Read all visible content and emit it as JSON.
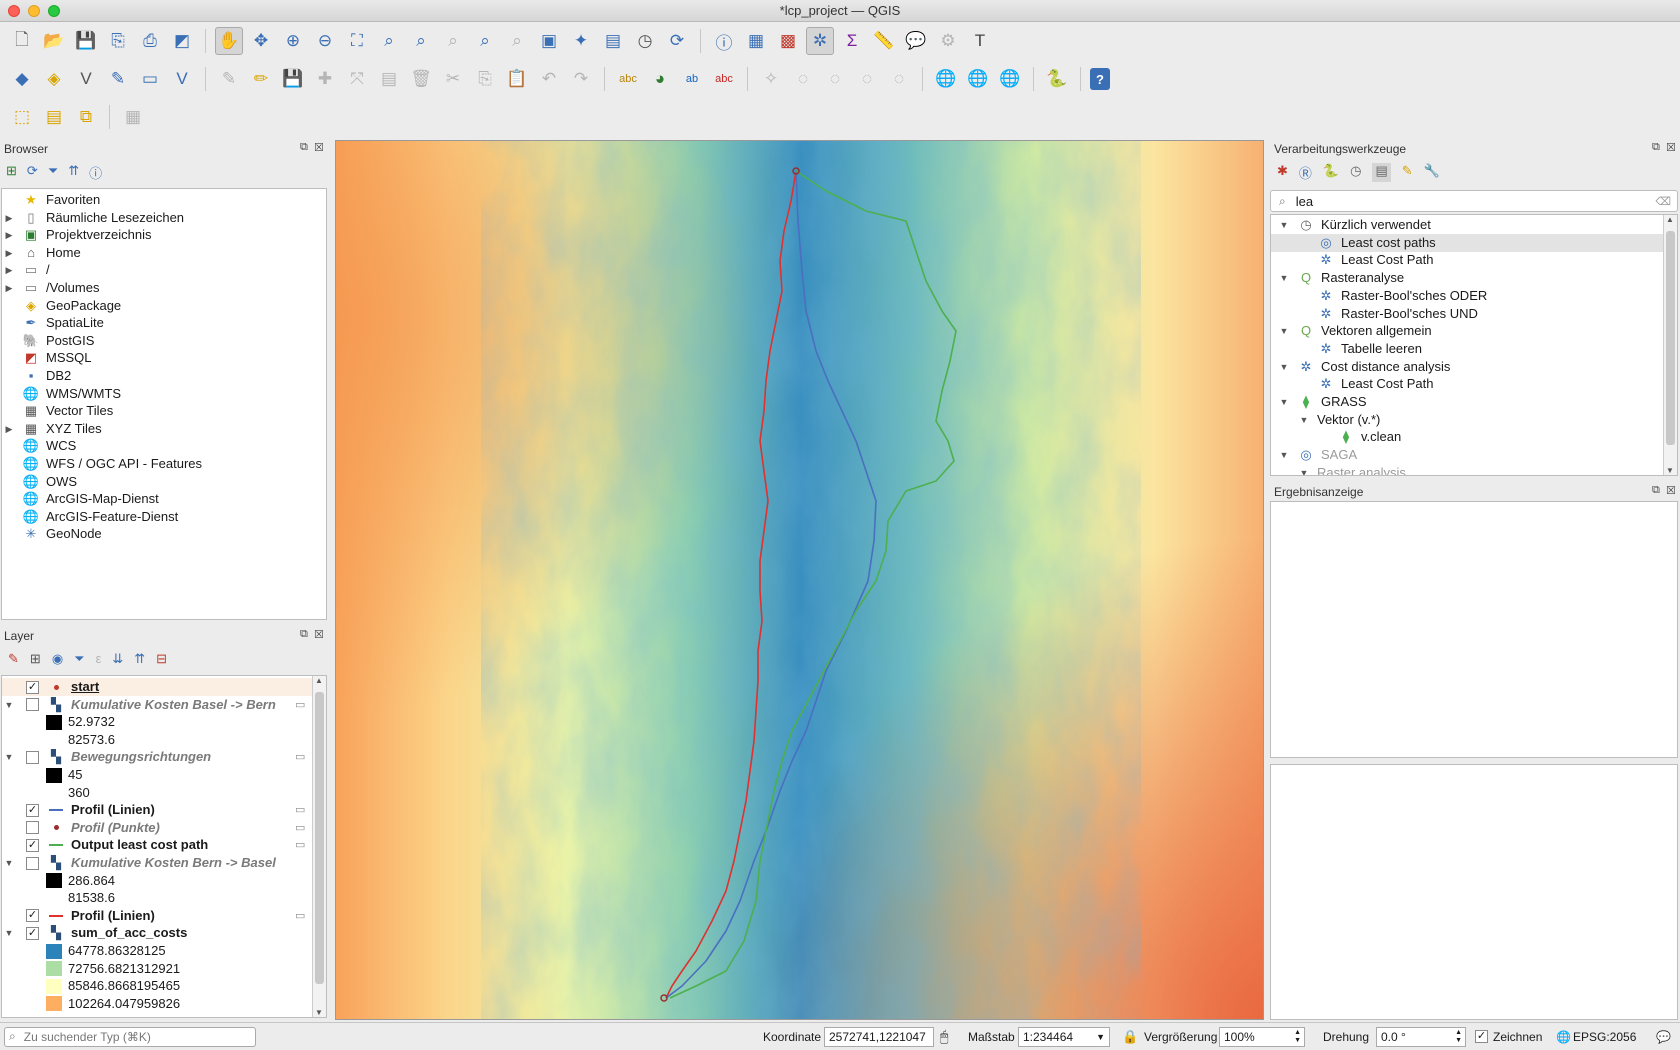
{
  "window": {
    "title": "*lcp_project — QGIS"
  },
  "browser": {
    "title": "Browser",
    "items": [
      {
        "label": "Favoriten",
        "icon": "star-icon",
        "expandable": false
      },
      {
        "label": "Räumliche Lesezeichen",
        "icon": "bookmark-icon",
        "expandable": true
      },
      {
        "label": "Projektverzeichnis",
        "icon": "project-folder-icon",
        "expandable": true
      },
      {
        "label": "Home",
        "icon": "home-icon",
        "expandable": true
      },
      {
        "label": "/",
        "icon": "folder-icon",
        "expandable": true
      },
      {
        "label": "/Volumes",
        "icon": "folder-icon",
        "expandable": true
      },
      {
        "label": "GeoPackage",
        "icon": "geopackage-icon",
        "expandable": false
      },
      {
        "label": "SpatiaLite",
        "icon": "spatialite-icon",
        "expandable": false
      },
      {
        "label": "PostGIS",
        "icon": "postgis-icon",
        "expandable": false
      },
      {
        "label": "MSSQL",
        "icon": "mssql-icon",
        "expandable": false
      },
      {
        "label": "DB2",
        "icon": "db2-icon",
        "expandable": false
      },
      {
        "label": "WMS/WMTS",
        "icon": "globe-icon",
        "expandable": false
      },
      {
        "label": "Vector Tiles",
        "icon": "grid-icon",
        "expandable": false
      },
      {
        "label": "XYZ Tiles",
        "icon": "grid-icon",
        "expandable": true
      },
      {
        "label": "WCS",
        "icon": "globe-icon",
        "expandable": false
      },
      {
        "label": "WFS / OGC API - Features",
        "icon": "globe-icon",
        "expandable": false
      },
      {
        "label": "OWS",
        "icon": "globe-icon",
        "expandable": false
      },
      {
        "label": "ArcGIS-Map-Dienst",
        "icon": "globe-icon",
        "expandable": false
      },
      {
        "label": "ArcGIS-Feature-Dienst",
        "icon": "globe-icon",
        "expandable": false
      },
      {
        "label": "GeoNode",
        "icon": "geonode-icon",
        "expandable": false
      }
    ]
  },
  "layers": {
    "title": "Layer",
    "items": [
      {
        "kind": "layer",
        "label": "start",
        "checked": true,
        "style": "bold-underline",
        "symbol": "point",
        "symbol_color": "#c0392b",
        "arrow": false,
        "embed": false
      },
      {
        "kind": "layer",
        "label": "Kumulative Kosten Basel -> Bern",
        "checked": false,
        "style": "italic",
        "symbol": "raster",
        "arrow": true,
        "embed": true
      },
      {
        "kind": "legend",
        "label": "52.9732",
        "color": "#000000"
      },
      {
        "kind": "legend",
        "label": "82573.6",
        "color": "#ffffff"
      },
      {
        "kind": "layer",
        "label": "Bewegungsrichtungen",
        "checked": false,
        "style": "italic",
        "symbol": "raster",
        "arrow": true,
        "embed": true
      },
      {
        "kind": "legend",
        "label": "45",
        "color": "#000000"
      },
      {
        "kind": "legend",
        "label": "360",
        "color": "#ffffff"
      },
      {
        "kind": "layer",
        "label": "Profil (Linien)",
        "checked": true,
        "style": "bold",
        "symbol": "line",
        "symbol_color": "#4a6fc0",
        "arrow": false,
        "embed": true
      },
      {
        "kind": "layer",
        "label": "Profil (Punkte)",
        "checked": false,
        "style": "italic",
        "symbol": "point",
        "symbol_color": "#9b2d2d",
        "arrow": false,
        "embed": true
      },
      {
        "kind": "layer",
        "label": "Output least cost path",
        "checked": true,
        "style": "bold",
        "symbol": "line",
        "symbol_color": "#4caf50",
        "arrow": false,
        "embed": true
      },
      {
        "kind": "layer",
        "label": "Kumulative Kosten Bern -> Basel",
        "checked": false,
        "style": "italic",
        "symbol": "raster",
        "arrow": true,
        "embed": false
      },
      {
        "kind": "legend",
        "label": "286.864",
        "color": "#000000"
      },
      {
        "kind": "legend",
        "label": "81538.6",
        "color": "#ffffff"
      },
      {
        "kind": "layer",
        "label": "Profil (Linien)",
        "checked": true,
        "style": "bold",
        "symbol": "line",
        "symbol_color": "#e03030",
        "arrow": false,
        "embed": true
      },
      {
        "kind": "layer",
        "label": "sum_of_acc_costs",
        "checked": true,
        "style": "bold",
        "symbol": "raster",
        "arrow": true,
        "embed": false
      },
      {
        "kind": "legend",
        "label": "64778.86328125",
        "color": "#2b83ba"
      },
      {
        "kind": "legend",
        "label": "72756.6821312921",
        "color": "#abdda4"
      },
      {
        "kind": "legend",
        "label": "85846.8668195465",
        "color": "#ffffbf"
      },
      {
        "kind": "legend",
        "label": "102264.047959826",
        "color": "#fdae61"
      }
    ]
  },
  "processing": {
    "title": "Verarbeitungswerkzeuge",
    "search_value": "lea",
    "tree": [
      {
        "label": "Kürzlich verwendet",
        "level": 0,
        "icon": "clock-icon",
        "arrow": true,
        "muted": false,
        "selected": false
      },
      {
        "label": "Least cost paths",
        "level": 1,
        "icon": "saga-icon",
        "arrow": false,
        "muted": false,
        "selected": true
      },
      {
        "label": "Least Cost Path",
        "level": 1,
        "icon": "gear-icon",
        "arrow": false,
        "muted": false,
        "selected": false
      },
      {
        "label": "Rasteranalyse",
        "level": 0,
        "icon": "qgis-icon",
        "arrow": true,
        "muted": false,
        "selected": false
      },
      {
        "label": "Raster-Bool'sches ODER",
        "level": 1,
        "icon": "gear-icon",
        "arrow": false,
        "muted": false,
        "selected": false
      },
      {
        "label": "Raster-Bool'sches UND",
        "level": 1,
        "icon": "gear-icon",
        "arrow": false,
        "muted": false,
        "selected": false
      },
      {
        "label": "Vektoren allgemein",
        "level": 0,
        "icon": "qgis-icon",
        "arrow": true,
        "muted": false,
        "selected": false
      },
      {
        "label": "Tabelle leeren",
        "level": 1,
        "icon": "gear-icon",
        "arrow": false,
        "muted": false,
        "selected": false
      },
      {
        "label": "Cost distance analysis",
        "level": 0,
        "icon": "gear-icon",
        "arrow": true,
        "muted": false,
        "selected": false
      },
      {
        "label": "Least Cost Path",
        "level": 1,
        "icon": "gear-icon",
        "arrow": false,
        "muted": false,
        "selected": false
      },
      {
        "label": "GRASS",
        "level": 0,
        "icon": "grass-icon",
        "arrow": true,
        "muted": false,
        "selected": false
      },
      {
        "label": "Vektor (v.*)",
        "level": 1,
        "icon": "",
        "arrow": true,
        "muted": false,
        "selected": false
      },
      {
        "label": "v.clean",
        "level": 2,
        "icon": "grass-icon",
        "arrow": false,
        "muted": false,
        "selected": false
      },
      {
        "label": "SAGA",
        "level": 0,
        "icon": "saga-icon",
        "arrow": true,
        "muted": true,
        "selected": false
      },
      {
        "label": "Raster analysis",
        "level": 1,
        "icon": "",
        "arrow": true,
        "muted": true,
        "selected": false
      }
    ]
  },
  "results": {
    "title": "Ergebnisanzeige"
  },
  "status": {
    "locator_placeholder": "Zu suchender Typ (⌘K)",
    "coordinate_label": "Koordinate",
    "coordinate_value": "2572741,1221047",
    "scale_label": "Maßstab",
    "scale_value": "1:234464",
    "magnifier_label": "Vergrößerung",
    "magnifier_value": "100%",
    "rotation_label": "Drehung",
    "rotation_value": "0.0 °",
    "render_label": "Zeichnen",
    "render_checked": true,
    "crs_label": "EPSG:2056"
  },
  "map": {
    "colors": {
      "low": "#2b83ba",
      "mid_low": "#abdda4",
      "mid": "#ffffbf",
      "mid_high": "#fdae61",
      "high": "#d7191c"
    },
    "paths": [
      {
        "name": "profil-linien-red",
        "color": "#e03030"
      },
      {
        "name": "profil-linien-blue",
        "color": "#4a6fc0"
      },
      {
        "name": "output-least-cost-path",
        "color": "#4caf50"
      }
    ]
  }
}
